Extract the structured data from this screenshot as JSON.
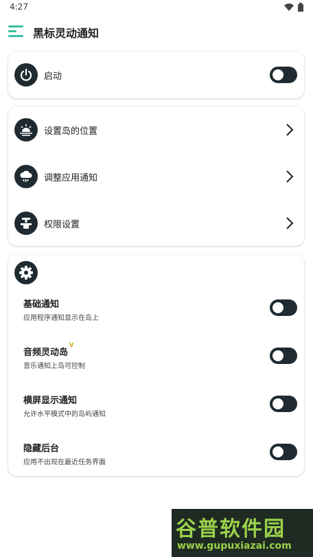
{
  "status": {
    "time": "4:27"
  },
  "app": {
    "title": "黑标灵动通知"
  },
  "power_card": {
    "label": "启动",
    "enabled": false
  },
  "nav_card": {
    "items": [
      {
        "label": "设置岛的位置",
        "icon": "sunrise-icon"
      },
      {
        "label": "调整应用通知",
        "icon": "cloud-rain-icon"
      },
      {
        "label": "权限设置",
        "icon": "valve-icon"
      }
    ]
  },
  "settings_card": {
    "icon": "gear-icon",
    "items": [
      {
        "title": "基础通知",
        "subtitle": "应用程序通知显示在岛上",
        "enabled": false
      },
      {
        "title": "音频灵动岛",
        "badge": "V",
        "subtitle": "音乐通知上岛可控制",
        "enabled": false
      },
      {
        "title": "横屏显示通知",
        "subtitle": "允许水平模式中的岛屿通知",
        "enabled": false
      },
      {
        "title": "隐藏后台",
        "subtitle": "应用不出现在最近任务界面",
        "enabled": false
      }
    ]
  },
  "watermark": {
    "name": "谷普软件园",
    "url": "www.gupuxiazai.com"
  },
  "colors": {
    "accent": "#3bbfa1",
    "dark": "#1f2b30",
    "watermark_green": "#9ad14b"
  }
}
